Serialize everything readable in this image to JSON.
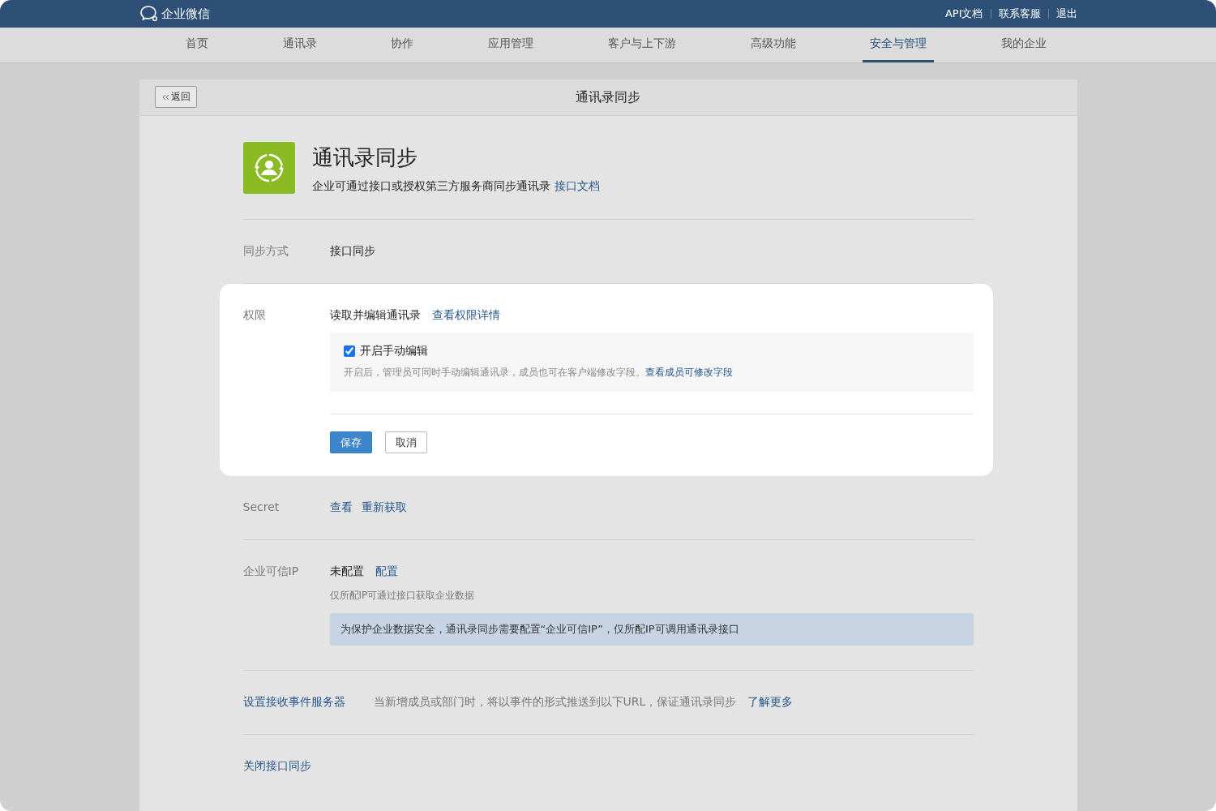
{
  "topbar": {
    "logo": "企业微信",
    "links": [
      "API文档",
      "联系客服",
      "退出"
    ]
  },
  "nav": [
    {
      "label": "首页",
      "selected": false
    },
    {
      "label": "通讯录",
      "selected": false
    },
    {
      "label": "协作",
      "selected": false
    },
    {
      "label": "应用管理",
      "selected": false
    },
    {
      "label": "客户与上下游",
      "selected": false
    },
    {
      "label": "高级功能",
      "selected": false
    },
    {
      "label": "安全与管理",
      "selected": true
    },
    {
      "label": "我的企业",
      "selected": false
    }
  ],
  "page": {
    "back": "返回",
    "title": "通讯录同步"
  },
  "intro": {
    "title": "通讯录同步",
    "description": "企业可通过接口或授权第三方服务商同步通讯录",
    "link": "接口文档"
  },
  "sync_mode": {
    "label": "同步方式",
    "value": "接口同步"
  },
  "permission": {
    "label": "权限",
    "value": "读取并编辑通讯录",
    "link": "查看权限详情",
    "option": {
      "label": "开启手动编辑",
      "checked": true,
      "hint": "开启后，管理员可同时手动编辑通讯录，成员也可在客户端修改字段。",
      "hint_link": "查看成员可修改字段"
    },
    "buttons": [
      {
        "label": "保存",
        "kind": "primary"
      },
      {
        "label": "取消",
        "kind": "default"
      }
    ]
  },
  "secret": {
    "label": "Secret",
    "links": [
      "查看",
      "重新获取"
    ]
  },
  "trusted_ip": {
    "label": "企业可信IP",
    "status": "未配置",
    "link": "配置",
    "hint": "仅所配IP可通过接口获取企业数据",
    "notice": "为保护企业数据安全，通讯录同步需要配置“企业可信IP”，仅所配IP可调用通讯录接口"
  },
  "event_server": {
    "link": "设置接收事件服务器",
    "description": "当新增成员或部门时，将以事件的形式推送到以下URL，保证通讯录同步",
    "more": "了解更多"
  },
  "close_link": "关闭接口同步"
}
